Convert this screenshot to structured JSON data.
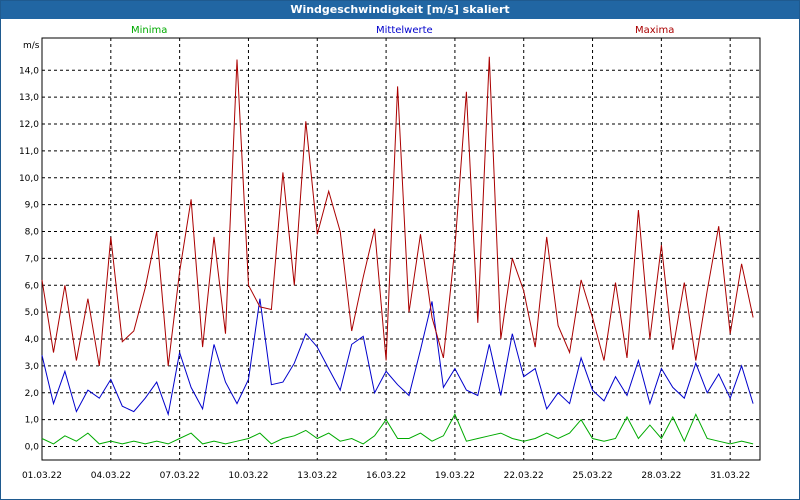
{
  "window": {
    "title": "Windgeschwindigkeit [m/s] skaliert"
  },
  "chart_data": {
    "type": "line",
    "title": "Windgeschwindigkeit [m/s] skaliert",
    "ylabel": "m/s",
    "xlabel": "",
    "ylim": [
      -0.5,
      15.2
    ],
    "xlim_days": [
      0,
      31.3
    ],
    "yticks": [
      0,
      1,
      2,
      3,
      4,
      5,
      6,
      7,
      8,
      9,
      10,
      11,
      12,
      13,
      14
    ],
    "ytick_labels": [
      "0,0",
      "1,0",
      "2,0",
      "3,0",
      "4,0",
      "5,0",
      "6,0",
      "7,0",
      "8,0",
      "9,0",
      "10,0",
      "11,0",
      "12,0",
      "13,0",
      "14,0"
    ],
    "xtick_labels": [
      "01.03.22",
      "04.03.22",
      "07.03.22",
      "10.03.22",
      "13.03.22",
      "16.03.22",
      "19.03.22",
      "22.03.22",
      "25.03.22",
      "28.03.22",
      "31.03.22"
    ],
    "grid": true,
    "legend_position": "top",
    "series": [
      {
        "name": "Minima",
        "color": "#00aa00",
        "x": [
          0,
          0.5,
          1,
          1.5,
          2,
          2.5,
          3,
          3.5,
          4,
          4.5,
          5,
          5.5,
          6,
          6.5,
          7,
          7.5,
          8,
          8.5,
          9,
          9.5,
          10,
          10.5,
          11,
          11.5,
          12,
          12.5,
          13,
          13.5,
          14,
          14.5,
          15,
          15.5,
          16,
          16.5,
          17,
          17.5,
          18,
          18.5,
          19,
          19.5,
          20,
          20.5,
          21,
          21.5,
          22,
          22.5,
          23,
          23.5,
          24,
          24.5,
          25,
          25.5,
          26,
          26.5,
          27,
          27.5,
          28,
          28.5,
          29,
          29.5,
          30,
          30.5,
          31
        ],
        "y": [
          0.3,
          0.1,
          0.4,
          0.2,
          0.5,
          0.1,
          0.2,
          0.1,
          0.2,
          0.1,
          0.2,
          0.1,
          0.3,
          0.5,
          0.1,
          0.2,
          0.1,
          0.2,
          0.3,
          0.5,
          0.1,
          0.3,
          0.4,
          0.6,
          0.3,
          0.5,
          0.2,
          0.3,
          0.1,
          0.4,
          1.0,
          0.3,
          0.3,
          0.5,
          0.2,
          0.4,
          1.2,
          0.2,
          0.3,
          0.4,
          0.5,
          0.3,
          0.2,
          0.3,
          0.5,
          0.3,
          0.5,
          1.0,
          0.3,
          0.2,
          0.3,
          1.1,
          0.3,
          0.8,
          0.3,
          1.1,
          0.2,
          1.2,
          0.3,
          0.2,
          0.1,
          0.2,
          0.1
        ]
      },
      {
        "name": "Mittelwerte",
        "color": "#0000cc",
        "x": [
          0,
          0.5,
          1,
          1.5,
          2,
          2.5,
          3,
          3.5,
          4,
          4.5,
          5,
          5.5,
          6,
          6.5,
          7,
          7.5,
          8,
          8.5,
          9,
          9.5,
          10,
          10.5,
          11,
          11.5,
          12,
          12.5,
          13,
          13.5,
          14,
          14.5,
          15,
          15.5,
          16,
          16.5,
          17,
          17.5,
          18,
          18.5,
          19,
          19.5,
          20,
          20.5,
          21,
          21.5,
          22,
          22.5,
          23,
          23.5,
          24,
          24.5,
          25,
          25.5,
          26,
          26.5,
          27,
          27.5,
          28,
          28.5,
          29,
          29.5,
          30,
          30.5,
          31
        ],
        "y": [
          3.4,
          1.6,
          2.8,
          1.3,
          2.1,
          1.8,
          2.5,
          1.5,
          1.3,
          1.8,
          2.4,
          1.2,
          3.5,
          2.2,
          1.4,
          3.8,
          2.4,
          1.6,
          2.5,
          5.5,
          2.3,
          2.4,
          3.1,
          4.2,
          3.7,
          2.9,
          2.1,
          3.8,
          4.1,
          2.0,
          2.8,
          2.3,
          1.9,
          3.6,
          5.4,
          2.2,
          2.9,
          2.1,
          1.9,
          3.8,
          1.9,
          4.2,
          2.6,
          2.9,
          1.4,
          2.0,
          1.6,
          3.3,
          2.1,
          1.7,
          2.6,
          1.9,
          3.2,
          1.6,
          2.9,
          2.2,
          1.8,
          3.1,
          2.0,
          2.7,
          1.8,
          3.0,
          1.6
        ]
      },
      {
        "name": "Maxima",
        "color": "#aa0000",
        "x": [
          0,
          0.5,
          1,
          1.5,
          2,
          2.5,
          3,
          3.5,
          4,
          4.5,
          5,
          5.5,
          6,
          6.5,
          7,
          7.5,
          8,
          8.5,
          9,
          9.5,
          10,
          10.5,
          11,
          11.5,
          12,
          12.5,
          13,
          13.5,
          14,
          14.5,
          15,
          15.5,
          16,
          16.5,
          17,
          17.5,
          18,
          18.5,
          19,
          19.5,
          20,
          20.5,
          21,
          21.5,
          22,
          22.5,
          23,
          23.5,
          24,
          24.5,
          25,
          25.5,
          26,
          26.5,
          27,
          27.5,
          28,
          28.5,
          29,
          29.5,
          30,
          30.5,
          31
        ],
        "y": [
          6.2,
          3.5,
          6.0,
          3.2,
          5.5,
          3.0,
          7.8,
          3.9,
          4.3,
          5.9,
          8.0,
          3.0,
          6.5,
          9.2,
          3.7,
          7.8,
          4.2,
          14.4,
          6.0,
          5.2,
          5.1,
          10.2,
          6.0,
          12.1,
          7.9,
          9.5,
          8.0,
          4.3,
          6.3,
          8.1,
          3.2,
          13.4,
          5.0,
          7.9,
          4.8,
          3.3,
          7.4,
          13.2,
          4.6,
          14.5,
          4.0,
          7.0,
          5.8,
          3.7,
          7.8,
          4.5,
          3.5,
          6.2,
          4.8,
          3.2,
          6.1,
          3.3,
          8.8,
          4.0,
          7.5,
          3.6,
          6.1,
          3.2,
          5.8,
          8.2,
          4.2,
          6.8,
          4.8
        ]
      }
    ]
  }
}
